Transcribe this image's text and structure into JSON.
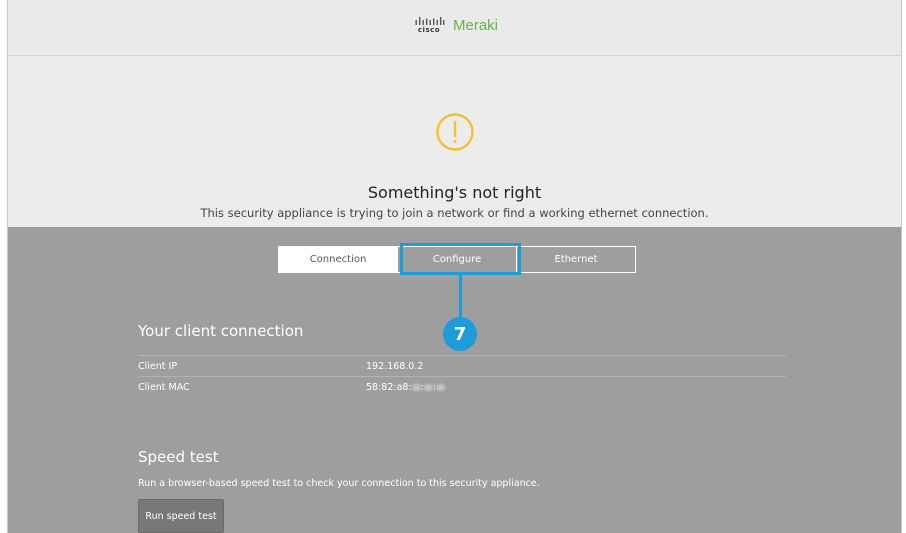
{
  "header": {
    "cisco_text": "cisco",
    "brand_name": "Meraki",
    "brand_color": "#67b346"
  },
  "alert": {
    "icon": "warning-circle-icon",
    "icon_color": "#f2c234",
    "title": "Something's not right",
    "subtitle": "This security appliance is trying to join a network or find a working ethernet connection."
  },
  "tabs": [
    {
      "label": "Connection",
      "active": true
    },
    {
      "label": "Configure",
      "active": false
    },
    {
      "label": "Ethernet",
      "active": false
    }
  ],
  "callout": {
    "number": "7",
    "color": "#1d9dd8"
  },
  "connection": {
    "title": "Your client connection",
    "rows": [
      {
        "label": "Client IP",
        "value": "192.168.0.2"
      },
      {
        "label": "Client MAC",
        "value": "58:82:a8:"
      }
    ]
  },
  "speed_test": {
    "title": "Speed test",
    "description": "Run a browser-based speed test to check your connection to this security appliance.",
    "button_label": "Run speed test"
  }
}
